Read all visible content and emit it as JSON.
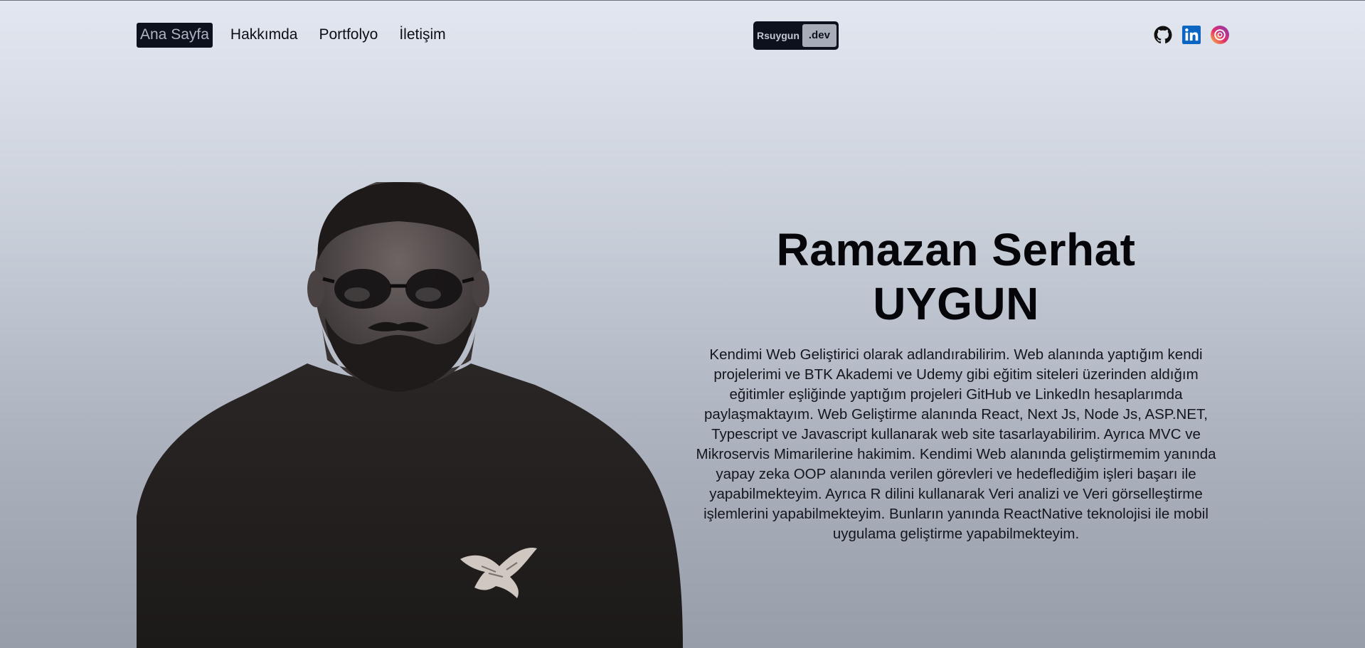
{
  "nav": {
    "links": [
      {
        "label": "Ana Sayfa",
        "active": true
      },
      {
        "label": "Hakkımda",
        "active": false
      },
      {
        "label": "Portfolyo",
        "active": false
      },
      {
        "label": "İletişim",
        "active": false
      }
    ]
  },
  "logo": {
    "name": "Rsuygun",
    "tld": ".dev"
  },
  "socials": [
    {
      "icon": "github-icon",
      "color": "#111111"
    },
    {
      "icon": "linkedin-icon",
      "color": "#0a66c2"
    },
    {
      "icon": "instagram-icon",
      "color": "#e1306c"
    }
  ],
  "hero": {
    "title": "Ramazan Serhat UYGUN",
    "description": "Kendimi Web Geliştirici olarak adlandırabilirim. Web alanında yaptığım kendi projelerimi ve BTK Akademi ve Udemy gibi eğitim siteleri üzerinden aldığım eğitimler eşliğinde yaptığım projeleri GitHub ve LinkedIn hesaplarımda paylaşmaktayım. Web Geliştirme alanında React, Next Js, Node Js, ASP.NET, Typescript ve Javascript kullanarak web site tasarlayabilirim. Ayrıca MVC ve Mikroservis Mimarilerine hakimim. Kendimi Web alanında geliştirmemim yanında yapay zeka OOP alanında verilen görevleri ve hedeflediğim işleri başarı ile yapabilmekteyim. Ayrıca R dilini kullanarak Veri analizi ve Veri görselleştirme işlemlerini yapabilmekteyim. Bunların yanında ReactNative teknolojisi ile mobil uygulama geliştirme yapabilmekteyim."
  },
  "colors": {
    "dark": "#0c111d",
    "muted": "#aeb4c2"
  }
}
